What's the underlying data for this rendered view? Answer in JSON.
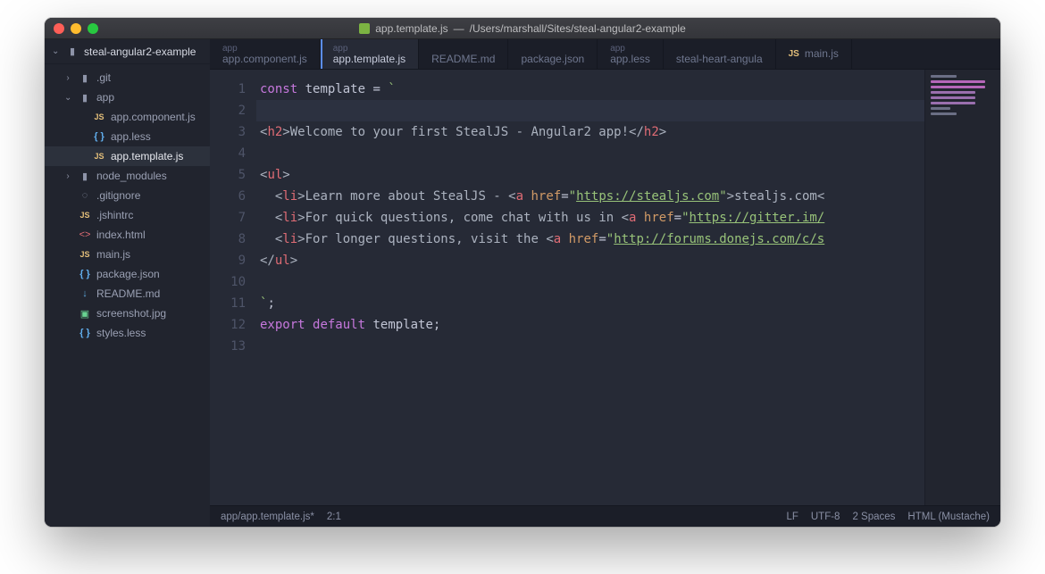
{
  "window": {
    "title_file": "app.template.js",
    "title_sep": " — ",
    "title_path": "/Users/marshall/Sites/steal-angular2-example"
  },
  "project_root": "steal-angular2-example",
  "tree": [
    {
      "depth": 0,
      "chev": "›",
      "icon": "folder",
      "label": ".git"
    },
    {
      "depth": 0,
      "chev": "⌄",
      "icon": "folder",
      "label": "app"
    },
    {
      "depth": 1,
      "chev": "",
      "icon": "js",
      "label": "app.component.js"
    },
    {
      "depth": 1,
      "chev": "",
      "icon": "less",
      "label": "app.less"
    },
    {
      "depth": 1,
      "chev": "",
      "icon": "js",
      "label": "app.template.js",
      "active": true
    },
    {
      "depth": 0,
      "chev": "›",
      "icon": "folder",
      "label": "node_modules"
    },
    {
      "depth": 0,
      "chev": "",
      "icon": "gh",
      "label": ".gitignore"
    },
    {
      "depth": 0,
      "chev": "",
      "icon": "js",
      "label": ".jshintrc"
    },
    {
      "depth": 0,
      "chev": "",
      "icon": "html",
      "label": "index.html"
    },
    {
      "depth": 0,
      "chev": "",
      "icon": "js",
      "label": "main.js"
    },
    {
      "depth": 0,
      "chev": "",
      "icon": "less",
      "label": "package.json"
    },
    {
      "depth": 0,
      "chev": "",
      "icon": "md",
      "label": "README.md"
    },
    {
      "depth": 0,
      "chev": "",
      "icon": "img",
      "label": "screenshot.jpg"
    },
    {
      "depth": 0,
      "chev": "",
      "icon": "less",
      "label": "styles.less"
    }
  ],
  "tabs": [
    {
      "sup": "app",
      "main": "app.component.js"
    },
    {
      "sup": "app",
      "main": "app.template.js",
      "active": true
    },
    {
      "sup": "",
      "main": "README.md"
    },
    {
      "sup": "",
      "main": "package.json"
    },
    {
      "sup": "app",
      "main": "app.less"
    },
    {
      "sup": "",
      "main": "steal-heart-angula"
    },
    {
      "sup": "",
      "main": "main.js",
      "icon": "js"
    }
  ],
  "code_lines": [
    {
      "n": 1,
      "html": "<span class='kw'>const</span> template = <span class='str'>`</span>"
    },
    {
      "n": 2,
      "html": "",
      "hl": true
    },
    {
      "n": 3,
      "html": "<span class='tagp'>&lt;</span><span class='tagn'>h2</span><span class='tagp'>&gt;</span><span class='txt'>Welcome to your first StealJS - Angular2 app!</span><span class='tagp'>&lt;/</span><span class='tagn'>h2</span><span class='tagp'>&gt;</span>"
    },
    {
      "n": 4,
      "html": ""
    },
    {
      "n": 5,
      "html": "<span class='tagp'>&lt;</span><span class='tagn'>ul</span><span class='tagp'>&gt;</span>"
    },
    {
      "n": 6,
      "html": "  <span class='tagp'>&lt;</span><span class='tagn'>li</span><span class='tagp'>&gt;</span><span class='txt'>Learn more about StealJS - </span><span class='tagp'>&lt;</span><span class='tagn'>a</span> <span class='attr'>href</span>=<span class='str'>\"</span><span class='str url'>https://stealjs.com</span><span class='str'>\"</span><span class='tagp'>&gt;</span><span class='txt'>stealjs.com</span><span class='tagp'>&lt;</span>"
    },
    {
      "n": 7,
      "html": "  <span class='tagp'>&lt;</span><span class='tagn'>li</span><span class='tagp'>&gt;</span><span class='txt'>For quick questions, come chat with us in </span><span class='tagp'>&lt;</span><span class='tagn'>a</span> <span class='attr'>href</span>=<span class='str'>\"</span><span class='str url'>https://gitter.im/</span>"
    },
    {
      "n": 8,
      "html": "  <span class='tagp'>&lt;</span><span class='tagn'>li</span><span class='tagp'>&gt;</span><span class='txt'>For longer questions, visit the </span><span class='tagp'>&lt;</span><span class='tagn'>a</span> <span class='attr'>href</span>=<span class='str'>\"</span><span class='str url'>http://forums.donejs.com/c/s</span>"
    },
    {
      "n": 9,
      "html": "<span class='tagp'>&lt;/</span><span class='tagn'>ul</span><span class='tagp'>&gt;</span>"
    },
    {
      "n": 10,
      "html": ""
    },
    {
      "n": 11,
      "html": "<span class='str'>`</span>;"
    },
    {
      "n": 12,
      "html": "<span class='kw'>export</span> <span class='kw'>default</span> template;"
    },
    {
      "n": 13,
      "html": ""
    }
  ],
  "status": {
    "path": "app/app.template.js*",
    "cursor": "2:1",
    "eol": "LF",
    "enc": "UTF-8",
    "indent": "2 Spaces",
    "lang": "HTML (Mustache)"
  },
  "icon_glyphs": {
    "folder": "▮",
    "js": "JS",
    "less": "{ }",
    "html": "<>",
    "md": "↓",
    "img": "▣",
    "gh": "◌"
  }
}
